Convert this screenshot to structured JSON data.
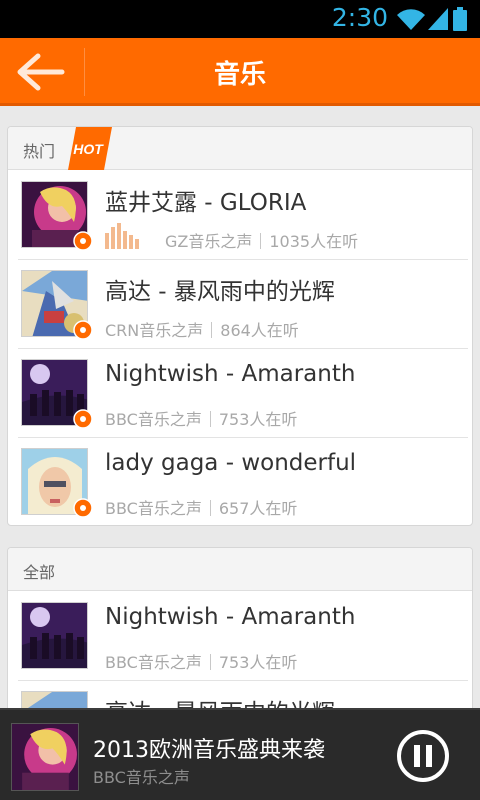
{
  "status_bar": {
    "time": "2:30",
    "icons": [
      "wifi-icon",
      "signal-icon",
      "battery-icon"
    ]
  },
  "header": {
    "title": "音乐",
    "back_icon": "back-arrow-icon"
  },
  "hot_section": {
    "label": "热门",
    "badge": "HOT",
    "items": [
      {
        "song": "蓝井艾露 - GLORIA",
        "station": "GZ音乐之声",
        "listeners": "1035人在听",
        "playing": true
      },
      {
        "song": "高达 - 暴风雨中的光辉",
        "station": "CRN音乐之声",
        "listeners": "864人在听",
        "playing": false
      },
      {
        "song": "Nightwish - Amaranth",
        "station": "BBC音乐之声",
        "listeners": "753人在听",
        "playing": false
      },
      {
        "song": "lady gaga - wonderful",
        "station": "BBC音乐之声",
        "listeners": "657人在听",
        "playing": false
      }
    ]
  },
  "all_section": {
    "label": "全部",
    "items": [
      {
        "song": "Nightwish - Amaranth",
        "station": "BBC音乐之声",
        "listeners": "753人在听"
      },
      {
        "song": "高达 - 暴风雨中的光辉",
        "station": "",
        "listeners": ""
      }
    ]
  },
  "player": {
    "title": "2013欧洲音乐盛典来袭",
    "station": "BBC音乐之声",
    "control_icon": "pause-icon"
  },
  "colors": {
    "accent": "#ff6a00",
    "status_blue": "#33b5e5",
    "player_bg": "#2a2a2a"
  }
}
